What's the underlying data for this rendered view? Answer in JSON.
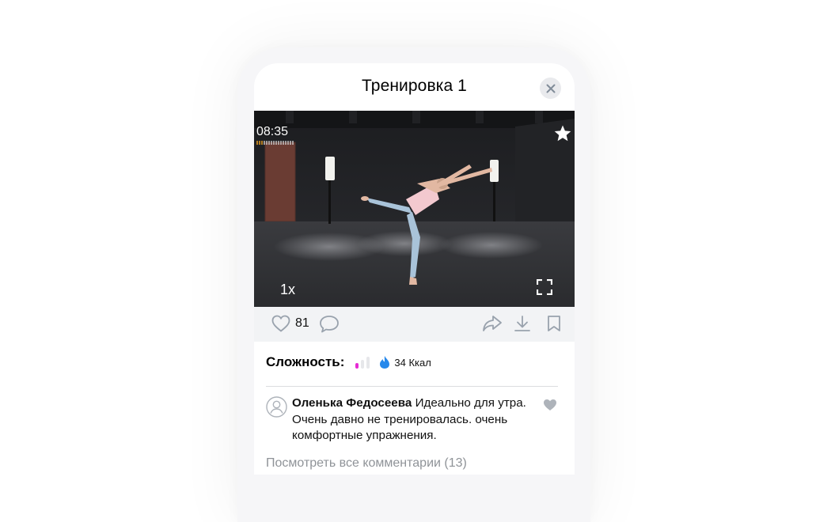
{
  "modal": {
    "title": "Тренировка 1"
  },
  "video": {
    "timer": "08:35",
    "speed": "1x"
  },
  "actions": {
    "like_count": "81"
  },
  "stats": {
    "difficulty_label": "Сложность:",
    "difficulty_level": 1,
    "difficulty_max": 3,
    "calories": "34 Ккал"
  },
  "comment": {
    "author": "Оленька Федосеева",
    "text": " Идеально для утра. Очень давно не тренировалась. очень комфортные упражнения."
  },
  "view_all_comments": "Посмотреть все комментарии (13)",
  "colors": {
    "accent_difficulty": "#e62bd4",
    "calorie_icon": "#2688eb",
    "icon_gray": "#99a2ad",
    "muted_text": "#8f9398"
  }
}
